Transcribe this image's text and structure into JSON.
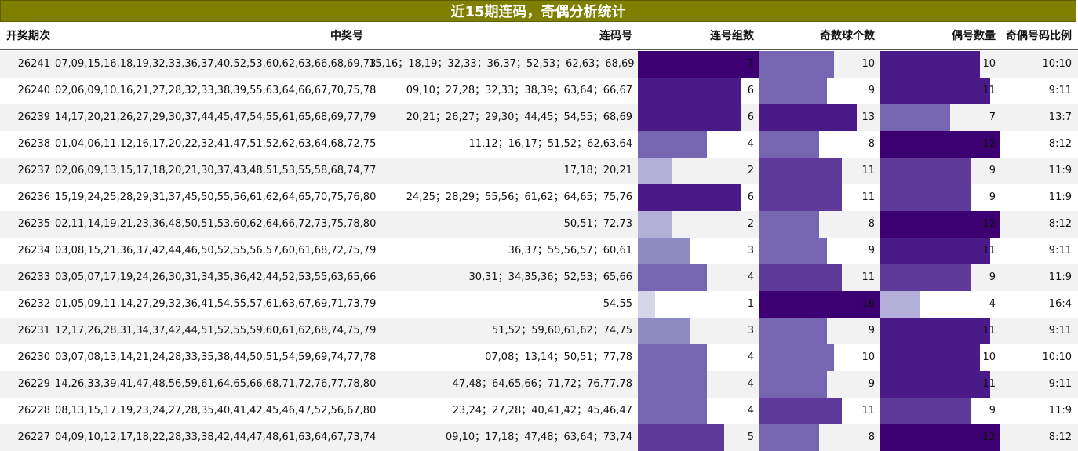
{
  "title": "近15期连码，奇偶分析统计",
  "headers": {
    "period": "开奖期次",
    "numbers": "中奖号",
    "consec": "连码号",
    "groups": "连号组数",
    "odd": "奇数球个数",
    "even": "偶号数量",
    "ratio": "奇偶号码比例"
  },
  "colors": {
    "title_bg": "#7f7f00",
    "bar_scale": [
      "#ececf5",
      "#d6d5ea",
      "#b2afd8",
      "#8e8bc2",
      "#7665b0",
      "#5e3a9a",
      "#4a1a88",
      "#3d0073"
    ]
  },
  "chart_data": {
    "type": "table",
    "title": "近15期连码，奇偶分析统计",
    "columns": [
      "开奖期次",
      "中奖号",
      "连码号",
      "连号组数",
      "奇数球个数",
      "偶号数量",
      "奇偶号码比例"
    ],
    "rows": [
      {
        "period": "26241",
        "numbers": "07,09,15,16,18,19,32,33,36,37,40,52,53,60,62,63,66,68,69,73",
        "consec": "15,16；18,19；32,33；36,37；52,53；62,63；68,69",
        "groups": 7,
        "odd": 10,
        "even": 10,
        "ratio": "10:10"
      },
      {
        "period": "26240",
        "numbers": "02,06,09,10,16,21,27,28,32,33,38,39,55,63,64,66,67,70,75,78",
        "consec": "09,10；27,28；32,33；38,39；63,64；66,67",
        "groups": 6,
        "odd": 9,
        "even": 11,
        "ratio": "9:11"
      },
      {
        "period": "26239",
        "numbers": "14,17,20,21,26,27,29,30,37,44,45,47,54,55,61,65,68,69,77,79",
        "consec": "20,21；26,27；29,30；44,45；54,55；68,69",
        "groups": 6,
        "odd": 13,
        "even": 7,
        "ratio": "13:7"
      },
      {
        "period": "26238",
        "numbers": "01,04,06,11,12,16,17,20,22,32,41,47,51,52,62,63,64,68,72,75",
        "consec": "11,12；16,17；51,52；62,63,64",
        "groups": 4,
        "odd": 8,
        "even": 12,
        "ratio": "8:12"
      },
      {
        "period": "26237",
        "numbers": "02,06,09,13,15,17,18,20,21,30,37,43,48,51,53,55,58,68,74,77",
        "consec": "17,18；20,21",
        "groups": 2,
        "odd": 11,
        "even": 9,
        "ratio": "11:9"
      },
      {
        "period": "26236",
        "numbers": "15,19,24,25,28,29,31,37,45,50,55,56,61,62,64,65,70,75,76,80",
        "consec": "24,25；28,29；55,56；61,62；64,65；75,76",
        "groups": 6,
        "odd": 11,
        "even": 9,
        "ratio": "11:9"
      },
      {
        "period": "26235",
        "numbers": "02,11,14,19,21,23,36,48,50,51,53,60,62,64,66,72,73,75,78,80",
        "consec": "50,51；72,73",
        "groups": 2,
        "odd": 8,
        "even": 12,
        "ratio": "8:12"
      },
      {
        "period": "26234",
        "numbers": "03,08,15,21,36,37,42,44,46,50,52,55,56,57,60,61,68,72,75,79",
        "consec": "36,37；55,56,57；60,61",
        "groups": 3,
        "odd": 9,
        "even": 11,
        "ratio": "9:11"
      },
      {
        "period": "26233",
        "numbers": "03,05,07,17,19,24,26,30,31,34,35,36,42,44,52,53,55,63,65,66",
        "consec": "30,31；34,35,36；52,53；65,66",
        "groups": 4,
        "odd": 11,
        "even": 9,
        "ratio": "11:9"
      },
      {
        "period": "26232",
        "numbers": "01,05,09,11,14,27,29,32,36,41,54,55,57,61,63,67,69,71,73,79",
        "consec": "54,55",
        "groups": 1,
        "odd": 16,
        "even": 4,
        "ratio": "16:4"
      },
      {
        "period": "26231",
        "numbers": "12,17,26,28,31,34,37,42,44,51,52,55,59,60,61,62,68,74,75,79",
        "consec": "51,52；59,60,61,62；74,75",
        "groups": 3,
        "odd": 9,
        "even": 11,
        "ratio": "9:11"
      },
      {
        "period": "26230",
        "numbers": "03,07,08,13,14,21,24,28,33,35,38,44,50,51,54,59,69,74,77,78",
        "consec": "07,08；13,14；50,51；77,78",
        "groups": 4,
        "odd": 10,
        "even": 10,
        "ratio": "10:10"
      },
      {
        "period": "26229",
        "numbers": "14,26,33,39,41,47,48,56,59,61,64,65,66,68,71,72,76,77,78,80",
        "consec": "47,48；64,65,66；71,72；76,77,78",
        "groups": 4,
        "odd": 9,
        "even": 11,
        "ratio": "9:11"
      },
      {
        "period": "26228",
        "numbers": "08,13,15,17,19,23,24,27,28,35,40,41,42,45,46,47,52,56,67,80",
        "consec": "23,24；27,28；40,41,42；45,46,47",
        "groups": 4,
        "odd": 11,
        "even": 9,
        "ratio": "11:9"
      },
      {
        "period": "26227",
        "numbers": "04,09,10,12,17,18,22,28,33,38,42,44,47,48,61,63,64,67,73,74",
        "consec": "09,10；17,18；47,48；63,64；73,74",
        "groups": 5,
        "odd": 8,
        "even": 12,
        "ratio": "8:12"
      }
    ],
    "bar_max": {
      "groups": 7,
      "odd": 16,
      "even": 12
    }
  }
}
